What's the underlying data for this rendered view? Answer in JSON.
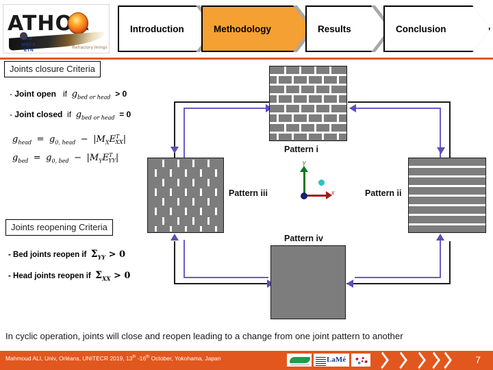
{
  "header": {
    "logo": {
      "wordmark": "ATHOR",
      "subtext": "EU\nMSCA\nETN",
      "tagline": "Refractory linings"
    },
    "tabs": [
      {
        "label": "Introduction",
        "active": false
      },
      {
        "label": "Methodology",
        "active": true
      },
      {
        "label": "Results",
        "active": false
      },
      {
        "label": "Conclusion",
        "active": false
      }
    ],
    "accent_color": "#E2571E",
    "active_tab_color": "#F5A033"
  },
  "criteria": {
    "closure": {
      "title": "Joints closure Criteria",
      "rules": [
        {
          "prefix": "- ",
          "bold": "Joint open",
          "mid": "if",
          "symbol": "g",
          "subscript": "bed or head",
          "operator": "> 0"
        },
        {
          "prefix": "- ",
          "bold": "Joint closed",
          "mid": "if",
          "symbol": "g",
          "subscript": "bed or head",
          "operator": "= 0"
        }
      ],
      "equations": [
        {
          "lhs": "g",
          "lhs_sub": "head",
          "rhs_first": "g",
          "rhs_first_sub": "0, head",
          "minus": "−",
          "abs_m": "M",
          "abs_m_sub": "X",
          "abs_e": "E",
          "abs_e_sup": "T",
          "abs_e_sub": "XX"
        },
        {
          "lhs": "g",
          "lhs_sub": "bed",
          "rhs_first": "g",
          "rhs_first_sub": "0, bed",
          "minus": "−",
          "abs_m": "M",
          "abs_m_sub": "Y",
          "abs_e": "E",
          "abs_e_sup": "T",
          "abs_e_sub": "YY"
        }
      ]
    },
    "reopening": {
      "title": "Joints reopening Criteria",
      "rules": [
        {
          "text": "- Bed joints reopen if",
          "symbol": "Σ",
          "subscript": "YY",
          "operator": "> 0"
        },
        {
          "text": "- Head joints reopen if",
          "symbol": "Σ",
          "subscript": "XX",
          "operator": "> 0"
        }
      ]
    }
  },
  "diagram": {
    "patterns": [
      {
        "id": "i",
        "label": "Pattern i",
        "description": "running-bond brickwork, bed and head joints open"
      },
      {
        "id": "ii",
        "label": "Pattern ii",
        "description": "bed joints open only"
      },
      {
        "id": "iii",
        "label": "Pattern iii",
        "description": "head joints open only"
      },
      {
        "id": "iv",
        "label": "Pattern iv",
        "description": "all joints closed"
      }
    ],
    "axes": {
      "x_label": "x",
      "y_label": "Y",
      "x_color": "#9e1b1b",
      "y_color": "#0b7a1e",
      "z_color": "#29c3c3"
    },
    "connector_color": "#6a5acd"
  },
  "caption": "In cyclic operation, joints will close and reopen leading to a change from one joint pattern to another",
  "footer": {
    "citation_pre": "Mahmoud ALI, Univ, Orléans, UNITECR 2019, 13",
    "citation_sup1": "th",
    "citation_mid": " -16",
    "citation_sup2": "th",
    "citation_post": " October, Yokohama, Japan",
    "logos": [
      "crocodile-logo",
      "lame-logo",
      "network-logo"
    ],
    "page_number": "7",
    "background": "#E2571E"
  }
}
